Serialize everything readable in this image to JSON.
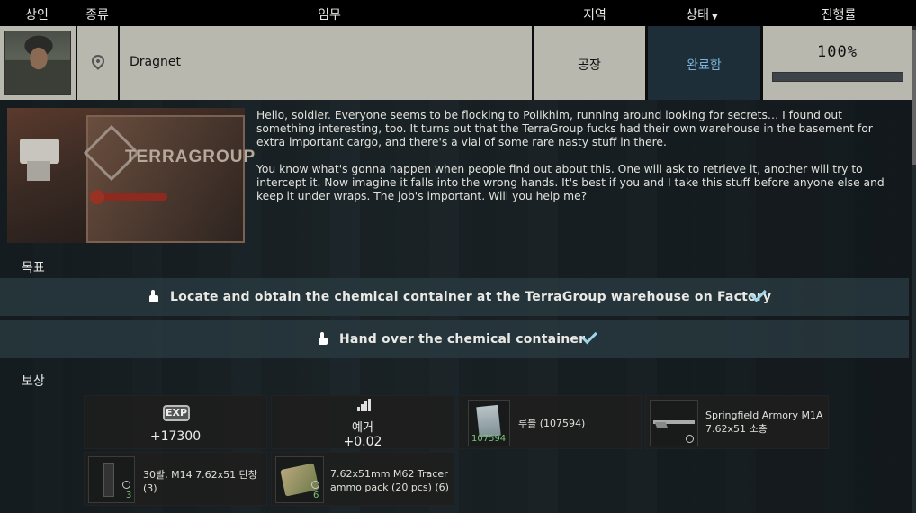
{
  "header": {
    "trader": "상인",
    "type": "종류",
    "task": "임무",
    "location": "지역",
    "status": "상태",
    "progress": "진행률"
  },
  "quest": {
    "name": "Dragnet",
    "location": "공장",
    "status": "완료함",
    "progress_text": "100%",
    "progress": 1.0,
    "type_icon": "map-pin-icon",
    "image_label": "TERRAGROUP"
  },
  "description": {
    "p1": "Hello, soldier. Everyone seems to be flocking to Polikhim, running around looking for secrets… I found out something interesting, too. It turns out that the TerraGroup fucks had their own warehouse in the basement for extra important cargo, and there's a vial of some rare nasty stuff in there.",
    "p2": "You know what's gonna happen when people find out about this. One will ask to retrieve it, another will try to intercept it. Now imagine it falls into the wrong hands. It's best if you and I take this stuff before anyone else and keep it under wraps. The job's important. Will you help me?"
  },
  "objectives": {
    "heading": "목표",
    "items": [
      {
        "text": "Locate and obtain the chemical container at the TerraGroup warehouse on Factory",
        "done": true
      },
      {
        "text": "Hand over the chemical container",
        "done": true
      }
    ]
  },
  "rewards": {
    "heading": "보상",
    "exp_label": "EXP",
    "exp_value": "+17300",
    "rep_label": "예거",
    "rep_value": "+0.02",
    "items": [
      {
        "name": "루블  (107594)",
        "qty": "107594"
      },
      {
        "name": "Springfield Armory M1A",
        "sub": "7.62x51 소총",
        "qty": ""
      },
      {
        "name": "30발, M14 7.62x51 탄창",
        "sub": "(3)",
        "qty": "3"
      },
      {
        "name": "7.62x51mm M62 Tracer",
        "sub": "ammo pack (20 pcs) (6)",
        "qty": "6"
      }
    ]
  },
  "colors": {
    "accent_check": "#9fd4ea",
    "status_bg": "#1e2e38",
    "status_text": "#79b5d8"
  }
}
